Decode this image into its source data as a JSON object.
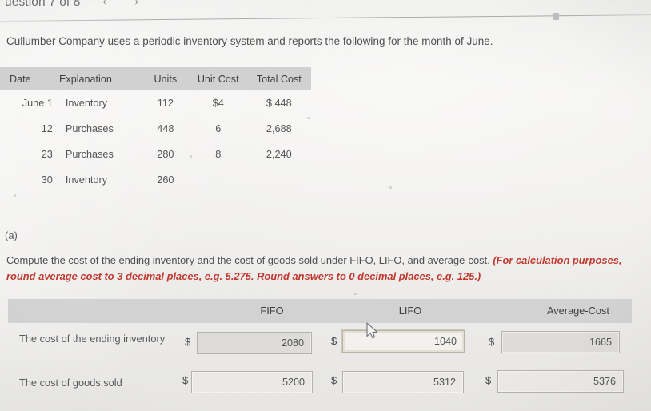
{
  "header": {
    "question_counter": "uestion 7 of 8",
    "prev_arrow": "‹",
    "next_arrow": "›"
  },
  "intro": {
    "text": "Cullumber Company uses a periodic inventory system and reports the following for the month of June."
  },
  "inventory_table": {
    "columns": [
      "Date",
      "Explanation",
      "Units",
      "Unit Cost",
      "Total Cost"
    ],
    "rows": [
      {
        "date": "June 1",
        "explanation": "Inventory",
        "units": "112",
        "unit_cost": "$4",
        "total_cost": "$ 448"
      },
      {
        "date": "12",
        "explanation": "Purchases",
        "units": "448",
        "unit_cost": "6",
        "total_cost": "2,688"
      },
      {
        "date": "23",
        "explanation": "Purchases",
        "units": "280",
        "unit_cost": "8",
        "total_cost": "2,240"
      },
      {
        "date": "30",
        "explanation": "Inventory",
        "units": "260",
        "unit_cost": "",
        "total_cost": ""
      }
    ]
  },
  "part": {
    "label": "(a)",
    "prompt_plain": "Compute the cost of the ending inventory and the cost of goods sold under FIFO, LIFO, and average-cost. ",
    "prompt_emphasis": "(For calculation purposes, round average cost to 3 decimal places, e.g. 5.275. Round answers to 0 decimal places, e.g. 125.)"
  },
  "answer_table": {
    "columns": [
      "FIFO",
      "LIFO",
      "Average-Cost"
    ],
    "currency_symbol": "$",
    "rows": [
      {
        "label": "The cost of the ending inventory",
        "fifo": "2080",
        "lifo": "1040",
        "average_cost": "1665"
      },
      {
        "label": "The cost of goods sold",
        "fifo": "5200",
        "lifo": "5312",
        "average_cost": "5376"
      }
    ]
  },
  "colors": {
    "page_background": "#eeedeb",
    "table_header_band": "#d1d1d1",
    "emphasis_red": "#c0392f",
    "field_border": "#b4b2ad",
    "field_fill": "#dedcd8",
    "text": "#4f4f50"
  }
}
